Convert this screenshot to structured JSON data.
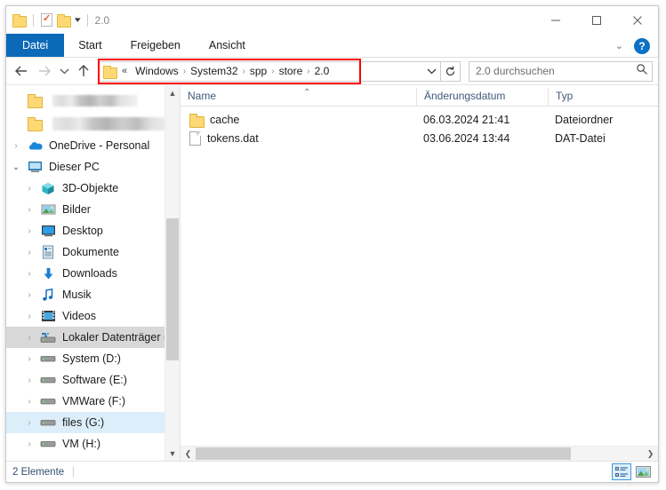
{
  "window": {
    "title": "2.0",
    "quick_access": [
      {
        "name": "folder-icon",
        "label": "Ordner"
      },
      {
        "name": "properties-icon",
        "label": "Eigenschaften"
      },
      {
        "name": "new-folder-icon",
        "label": "Neuer Ordner"
      },
      {
        "name": "customize-caret-icon",
        "label": "Symbolleiste anpassen"
      }
    ],
    "controls": {
      "minimize": "Minimieren",
      "maximize": "Maximieren",
      "close": "Schließen"
    }
  },
  "ribbon": {
    "tabs": [
      {
        "label": "Datei",
        "active": true
      },
      {
        "label": "Start",
        "active": false
      },
      {
        "label": "Freigeben",
        "active": false
      },
      {
        "label": "Ansicht",
        "active": false
      }
    ],
    "collapse_label": "Menüband minimieren",
    "help_label": "?"
  },
  "address": {
    "back_label": "Zurück",
    "forward_label": "Vorwärts",
    "recent_label": "Zuletzt besuchte Orte",
    "up_label": "Eine Ebene nach oben",
    "breadcrumb_prefix": "«",
    "breadcrumbs": [
      "Windows",
      "System32",
      "spp",
      "store",
      "2.0"
    ],
    "separator": "›",
    "dropdown_label": "Vorherige Orte",
    "refresh_label": "Aktualisieren",
    "highlight_color": "#ff0000"
  },
  "search": {
    "value": "",
    "placeholder": "2.0 durchsuchen",
    "icon": "search-icon"
  },
  "sidebar": {
    "blurred_items": [
      {
        "name": "redacted-folder-1"
      },
      {
        "name": "redacted-folder-2"
      }
    ],
    "items": [
      {
        "label": "OneDrive - Personal",
        "icon": "onedrive-cloud-icon",
        "level": 1,
        "state": "collapsed"
      },
      {
        "label": "Dieser PC",
        "icon": "this-pc-icon",
        "level": 1,
        "state": "expanded"
      },
      {
        "label": "3D-Objekte",
        "icon": "3d-objects-icon",
        "level": 2,
        "state": "collapsed"
      },
      {
        "label": "Bilder",
        "icon": "pictures-icon",
        "level": 2,
        "state": "collapsed"
      },
      {
        "label": "Desktop",
        "icon": "desktop-icon",
        "level": 2,
        "state": "collapsed"
      },
      {
        "label": "Dokumente",
        "icon": "documents-icon",
        "level": 2,
        "state": "collapsed"
      },
      {
        "label": "Downloads",
        "icon": "downloads-icon",
        "level": 2,
        "state": "collapsed"
      },
      {
        "label": "Musik",
        "icon": "music-icon",
        "level": 2,
        "state": "collapsed"
      },
      {
        "label": "Videos",
        "icon": "videos-icon",
        "level": 2,
        "state": "collapsed"
      },
      {
        "label": "Lokaler Datenträger (C:)",
        "icon": "local-disk-icon",
        "level": 2,
        "state": "collapsed",
        "highlight": "hover"
      },
      {
        "label": "System (D:)",
        "icon": "drive-icon",
        "level": 2,
        "state": "collapsed"
      },
      {
        "label": "Software (E:)",
        "icon": "drive-icon",
        "level": 2,
        "state": "collapsed"
      },
      {
        "label": "VMWare (F:)",
        "icon": "drive-icon",
        "level": 2,
        "state": "collapsed"
      },
      {
        "label": "files (G:)",
        "icon": "drive-icon",
        "level": 2,
        "state": "collapsed",
        "highlight": "selected"
      },
      {
        "label": "VM (H:)",
        "icon": "drive-icon",
        "level": 2,
        "state": "collapsed"
      }
    ]
  },
  "filelist": {
    "columns": [
      {
        "label": "Name",
        "sorted": "asc"
      },
      {
        "label": "Änderungsdatum",
        "sorted": null
      },
      {
        "label": "Typ",
        "sorted": null
      }
    ],
    "rows": [
      {
        "name": "cache",
        "date": "06.03.2024 21:41",
        "type": "Dateiordner",
        "icon": "folder-icon"
      },
      {
        "name": "tokens.dat",
        "date": "03.06.2024 13:44",
        "type": "DAT-Datei",
        "icon": "file-icon"
      }
    ]
  },
  "statusbar": {
    "item_count": "2 Elemente",
    "views": [
      {
        "name": "details-view-button",
        "label": "Details",
        "active": true
      },
      {
        "name": "large-icons-view-button",
        "label": "Große Symbole",
        "active": false
      }
    ]
  }
}
